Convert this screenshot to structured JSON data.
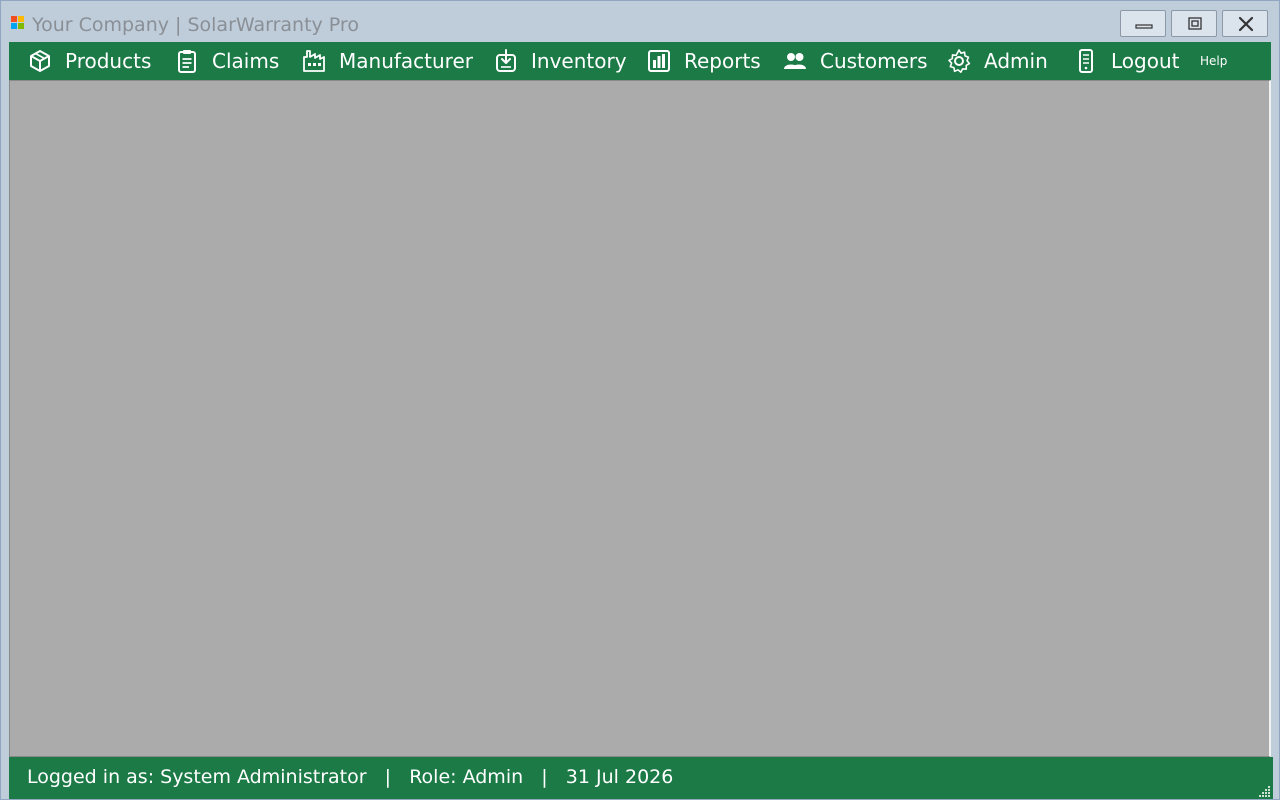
{
  "window": {
    "title": "Your Company | SolarWarranty Pro",
    "controls": {
      "minimize": "minimize-icon",
      "maximize": "restore-icon",
      "close": "close-icon"
    }
  },
  "menu": {
    "items": [
      {
        "label": "Products",
        "icon": "package-icon"
      },
      {
        "label": "Claims",
        "icon": "clipboard-icon"
      },
      {
        "label": "Manufacturer",
        "icon": "factory-icon"
      },
      {
        "label": "Inventory",
        "icon": "inventory-icon"
      },
      {
        "label": "Reports",
        "icon": "bar-chart-icon"
      },
      {
        "label": "Customers",
        "icon": "users-icon"
      },
      {
        "label": "Admin",
        "icon": "gear-icon"
      },
      {
        "label": "Logout",
        "icon": "phone-icon"
      }
    ],
    "help_label": "Help"
  },
  "status": {
    "user_text": "Logged in as: System Administrator",
    "separator": "|",
    "role_text": "Role: Admin",
    "date_text": "31 Jul 2026"
  },
  "colors": {
    "brand_green": "#1b7a46",
    "workspace_gray": "#ababab",
    "window_frame": "#bfcddb"
  }
}
